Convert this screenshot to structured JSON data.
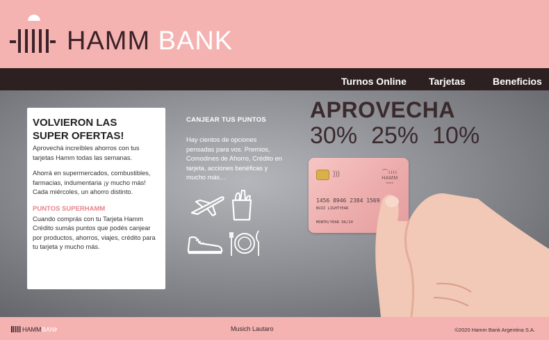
{
  "header": {
    "brand_hamm": "HAMM",
    "brand_bank": "BANK"
  },
  "nav": {
    "items": [
      {
        "label": "Turnos Online"
      },
      {
        "label": "Tarjetas"
      },
      {
        "label": "Beneficios"
      }
    ]
  },
  "offer_card": {
    "title_line1": "VOLVIERON LAS",
    "title_line2": "SUPER OFERTAS!",
    "paragraph1": "Aprovechá increíbles ahorros con tus tarjetas Hamm todas las semanas.",
    "paragraph2": "Ahorrá en supermercados, combustibles, farmacias, indumentaria ¡y mucho más! Cada miércoles, un ahorro distinto.",
    "subtitle": "PUNTOS SUPERHAMM",
    "paragraph3": "Cuando comprás con tu Tarjeta Hamm Crédito sumás puntos que podés canjear por productos, ahorros, viajes, crédito para tu tarjeta y mucho más."
  },
  "canjear": {
    "title": "CANJEAR TUS PUNTOS",
    "text": "Hay cientos de opciones pensadas para vos. Premios, Comodines de Ahorro, Crédito en tarjeta, acciones benéficas y mucho más…",
    "icons": [
      "airplane-icon",
      "grocery-bag-icon",
      "sneaker-icon",
      "dinner-plate-icon"
    ]
  },
  "promo": {
    "headline": "APROVECHA",
    "percents": [
      "30%",
      "25%",
      "10%"
    ]
  },
  "credit_card": {
    "number": "1456 8946 2384 1569",
    "holder": "BUZZ LIGHTYEAR",
    "expiry": "MONTH/YEAR 06/24",
    "brand": "HAMM",
    "brand_sub": "bank"
  },
  "footer": {
    "author": "Musich Lautaro",
    "copyright": "©2020 Hamm Bank Argentina S.A."
  },
  "colors": {
    "brand_pink": "#f4b2b1",
    "nav_dark": "#2d2020",
    "accent_pink": "#e8838a",
    "text_dark": "#3a2228"
  }
}
